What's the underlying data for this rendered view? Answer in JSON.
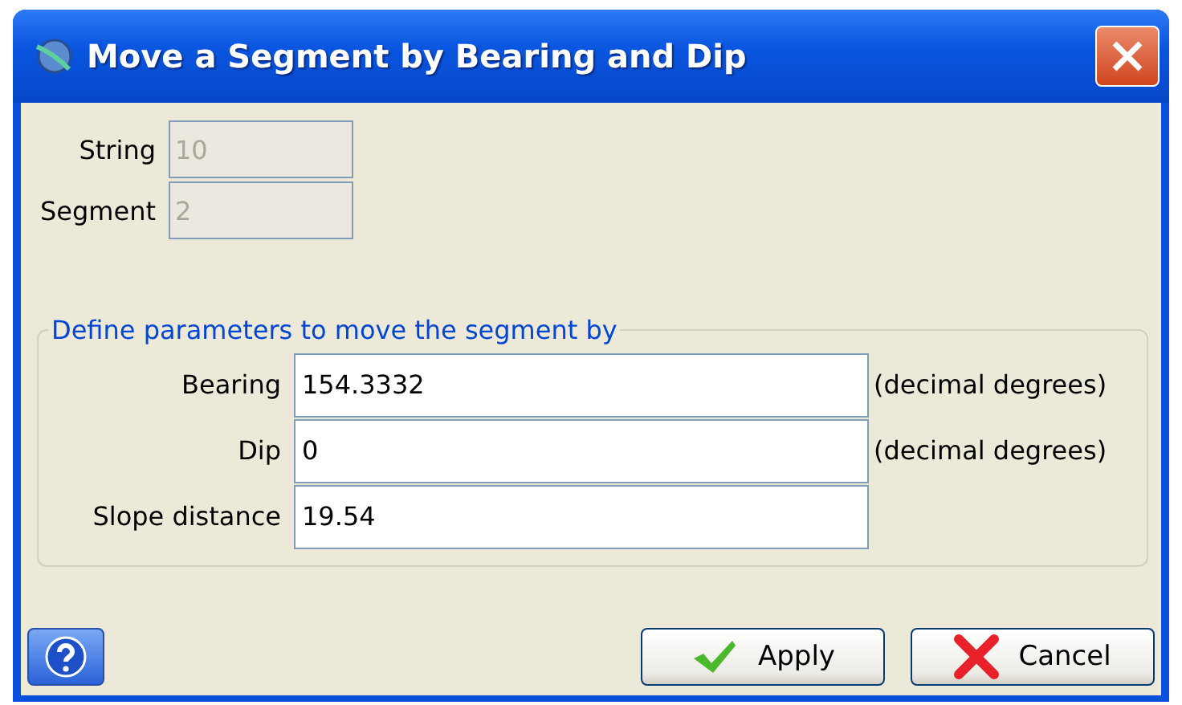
{
  "window": {
    "title": "Move a Segment by Bearing and Dip"
  },
  "identity_fields": [
    {
      "label": "String",
      "value": "10",
      "disabled": true
    },
    {
      "label": "Segment",
      "value": "2",
      "disabled": true
    }
  ],
  "parameters": {
    "legend": "Define parameters to move the segment by",
    "fields": [
      {
        "label": "Bearing",
        "value": "154.3332",
        "unit": "(decimal degrees)"
      },
      {
        "label": "Dip",
        "value": "0",
        "unit": "(decimal degrees)"
      },
      {
        "label": "Slope distance",
        "value": "19.54"
      }
    ]
  },
  "buttons": [
    {
      "kind": "apply",
      "label": "Apply"
    },
    {
      "kind": "cancel",
      "label": "Cancel"
    }
  ]
}
